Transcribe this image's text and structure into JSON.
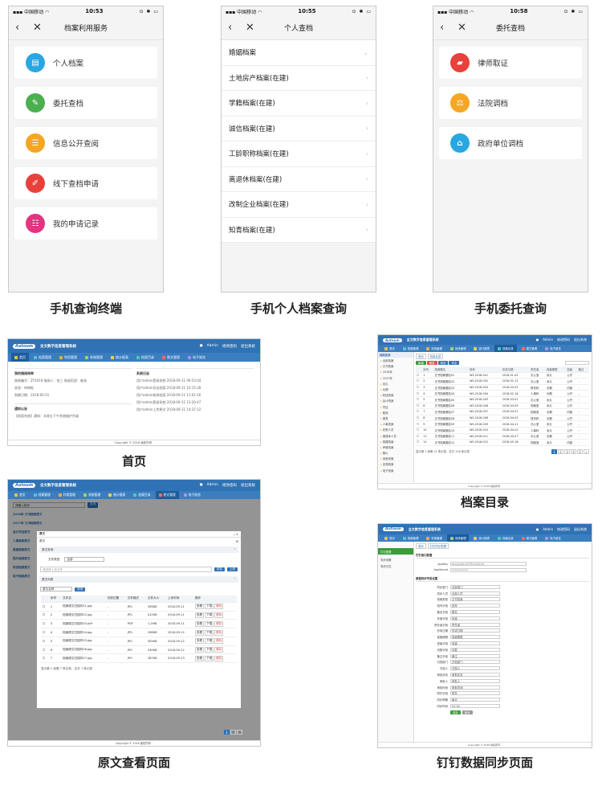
{
  "phone_status": {
    "carrier": "中国移动",
    "screen1_time": "10:53",
    "screen2_time": "10:55",
    "screen3_time": "10:58",
    "right_icons": "⊙ ✱ ▭"
  },
  "screen1": {
    "title": "档案利用服务",
    "items": [
      {
        "label": "个人档案",
        "icon": "person-file-icon",
        "color": "#29a7e1"
      },
      {
        "label": "委托查档",
        "icon": "delegate-icon",
        "color": "#4cb050"
      },
      {
        "label": "信息公开查阅",
        "icon": "info-public-icon",
        "color": "#f5a623"
      },
      {
        "label": "线下查档申请",
        "icon": "offline-apply-icon",
        "color": "#e8413c"
      },
      {
        "label": "我的申请记录",
        "icon": "my-records-icon",
        "color": "#e3347f"
      }
    ],
    "caption": "手机查询终端"
  },
  "screen2": {
    "title": "个人查档",
    "items": [
      "婚姻档案",
      "土地房产档案(在建)",
      "学籍档案(在建)",
      "诚信档案(在建)",
      "工龄职称档案(在建)",
      "离退休档案(在建)",
      "改制企业档案(在建)",
      "知青档案(在建)"
    ],
    "caption": "手机个人档案查询"
  },
  "screen3": {
    "title": "委托查档",
    "items": [
      {
        "label": "律师取证",
        "icon": "briefcase-icon",
        "color": "#e8413c"
      },
      {
        "label": "法院调档",
        "icon": "scales-icon",
        "color": "#f5a623"
      },
      {
        "label": "政府单位调档",
        "icon": "government-icon",
        "color": "#29a7e1"
      }
    ],
    "caption": "手机委托查询"
  },
  "desktop": {
    "logo": "Autoum",
    "system_title": "全文数字信息管理系统",
    "user": "Admin",
    "top_links": [
      "修改密码",
      "退出系统"
    ],
    "menu": [
      "首页",
      "档案管理",
      "利用管理",
      "系统管理",
      "统计报表",
      "档案目录",
      "原文管理",
      "电子阅览"
    ],
    "footer": "Copyright © 2018 版权所有 ·"
  },
  "home": {
    "left_title": "我的借阅待审",
    "left_lines": [
      "借阅编号：ZY2018 借阅人：张三 借阅用途：查阅",
      "状态：待审批",
      "到期日期：2018-06-01"
    ],
    "left_title2": "通知公告",
    "left_lines2": [
      "【档案系统】通知：本周五下午系统维护升级"
    ],
    "right_title": "系统日志",
    "right_lines": [
      "用户admin登录系统 2018-09-11 09:53:04",
      "用户admin导出档案 2018-09-11 10:15:28",
      "用户admin修改档案 2018-09-11 11:02:16",
      "用户admin登录系统 2018-09-11 13:20:47",
      "用户admin上传原文 2018-09-11 14:37:12"
    ],
    "caption": "首页"
  },
  "catalog": {
    "sidebar_title": "档案目录",
    "tree": [
      "全部档案",
      "文书档案",
      "2018年",
      "2017年",
      "永久",
      "长期",
      "科技档案",
      "会计档案",
      "凭证",
      "账簿",
      "报表",
      "人事档案",
      "在职人员",
      "离退休人员",
      "基建档案",
      "声像档案",
      "照片",
      "录音录像",
      "实物档案",
      "电子档案"
    ],
    "tabs": [
      "首页",
      "档案目录"
    ],
    "toolbar": [
      "新增",
      "删除",
      "修改",
      "导出"
    ],
    "headers": [
      "",
      "序号",
      "档案题名",
      "档号",
      "形成日期",
      "责任者",
      "保管期限",
      "密级",
      "备注"
    ],
    "rows": [
      [
        "1",
        "文书档案题名01",
        "WS-2018-001",
        "2018-01-05",
        "办公室",
        "永久",
        "公开",
        "-"
      ],
      [
        "2",
        "文书档案题名02",
        "WS-2018-002",
        "2018-01-12",
        "办公室",
        "永久",
        "公开",
        "-"
      ],
      [
        "3",
        "文书档案题名03",
        "WS-2018-003",
        "2018-02-02",
        "财务科",
        "长期",
        "内部",
        "-"
      ],
      [
        "4",
        "文书档案题名04",
        "WS-2018-004",
        "2018-02-16",
        "人事科",
        "长期",
        "公开",
        "-"
      ],
      [
        "5",
        "文书档案题名05",
        "WS-2018-005",
        "2018-03-01",
        "办公室",
        "永久",
        "公开",
        "-"
      ],
      [
        "6",
        "文书档案题名06",
        "WS-2018-006",
        "2018-03-09",
        "档案室",
        "永久",
        "公开",
        "-"
      ],
      [
        "7",
        "文书档案题名07",
        "WS-2018-007",
        "2018-03-22",
        "档案室",
        "长期",
        "内部",
        "-"
      ],
      [
        "8",
        "文书档案题名08",
        "WS-2018-008",
        "2018-04-03",
        "财务科",
        "长期",
        "公开",
        "-"
      ],
      [
        "9",
        "文书档案题名09",
        "WS-2018-009",
        "2018-04-11",
        "办公室",
        "永久",
        "公开",
        "-"
      ],
      [
        "10",
        "文书档案题名10",
        "WS-2018-010",
        "2018-04-20",
        "人事科",
        "永久",
        "公开",
        "-"
      ],
      [
        "11",
        "文书档案题名11",
        "WS-2018-011",
        "2018-05-07",
        "办公室",
        "长期",
        "公开",
        "-"
      ],
      [
        "12",
        "文书档案题名12",
        "WS-2018-012",
        "2018-05-18",
        "档案室",
        "永久",
        "内部",
        "-"
      ]
    ],
    "pager_text": "显示第 1 到第 12 条记录，总共 128 条记录",
    "pages": [
      "1",
      "2",
      "3",
      "4",
      "5",
      "»"
    ],
    "caption": "档案目录"
  },
  "viewer": {
    "tabs": [
      "首页",
      "原文管理"
    ],
    "search_placeholder": "请输入档号",
    "search_button": "查询",
    "bg_items": [
      "2018年 文书档案原文",
      "2017年 文书档案原文",
      "会计凭证原文",
      "人事档案原文",
      "基建档案原文",
      "照片档案原文",
      "科技档案原文",
      "电子档案原文"
    ],
    "modal_title": "原文",
    "modal_sub": "原文",
    "section1": "原文查询",
    "select_label": "文件类型",
    "select_value": "全部",
    "upload_placeholder": "请选择上传文件",
    "browse": "浏览",
    "upload": "上传",
    "section2": "原文列表",
    "filter_value": "原文名称",
    "filter_button": "查询",
    "headers": [
      "",
      "序号",
      "文件名",
      "存放位置",
      "文件格式",
      "文件大小",
      "上传时间",
      "操作"
    ],
    "rows": [
      [
        "1",
        "档案原文扫描件01.jpg",
        "-",
        "JPG",
        "356KB",
        "2018-09-11"
      ],
      [
        "2",
        "档案原文扫描件02.jpg",
        "-",
        "JPG",
        "412KB",
        "2018-09-11"
      ],
      [
        "3",
        "档案原文扫描件03.pdf",
        "-",
        "PDF",
        "1.2MB",
        "2018-09-11"
      ],
      [
        "4",
        "档案原文扫描件04.jpg",
        "-",
        "JPG",
        "298KB",
        "2018-09-12"
      ],
      [
        "5",
        "档案原文扫描件05.jpg",
        "-",
        "JPG",
        "305KB",
        "2018-09-12"
      ],
      [
        "6",
        "档案原文扫描件06.jpg",
        "-",
        "JPG",
        "330KB",
        "2018-09-12"
      ],
      [
        "7",
        "档案原文扫描件07.jpg",
        "-",
        "JPG",
        "287KB",
        "2018-09-13"
      ]
    ],
    "ops": [
      "查看",
      "下载",
      "删除"
    ],
    "modal_footer": "显示第 1 到第 7 条记录，总共 7 条记录",
    "pages": [
      "1",
      "2",
      "3"
    ],
    "caption": "原文查看页面"
  },
  "dingtalk": {
    "sidebar": [
      "钉钉配置",
      "同步设置",
      "同步日志"
    ],
    "tabs": [
      "首页",
      "钉钉同步配置"
    ],
    "section1": "钉钉接口配置",
    "fields1": [
      {
        "k": "AppKey",
        "v": "ding2a8c1b7f9e4d3c5a"
      },
      {
        "k": "AppSecret",
        "v": "************"
      }
    ],
    "section2": "数据同步字段设置",
    "fields2": [
      {
        "k": "同步部门",
        "v": "全部部门"
      },
      {
        "k": "同步人员",
        "v": "全部人员"
      },
      {
        "k": "档案类型",
        "v": "文书档案"
      },
      {
        "k": "档号字段",
        "v": "档号"
      },
      {
        "k": "题名字段",
        "v": "题名"
      },
      {
        "k": "年度字段",
        "v": "年度"
      },
      {
        "k": "责任者字段",
        "v": "责任者"
      },
      {
        "k": "形成日期",
        "v": "形成日期"
      },
      {
        "k": "保管期限",
        "v": "保管期限"
      },
      {
        "k": "密级字段",
        "v": "密级"
      },
      {
        "k": "页数字段",
        "v": "页数"
      },
      {
        "k": "备注字段",
        "v": "备注"
      },
      {
        "k": "归档部门",
        "v": "归档部门"
      },
      {
        "k": "归档人",
        "v": "归档人"
      },
      {
        "k": "审批状态",
        "v": "审批状态"
      },
      {
        "k": "审批人",
        "v": "审批人"
      },
      {
        "k": "审批时间",
        "v": "审批时间"
      },
      {
        "k": "附件字段",
        "v": "附件"
      },
      {
        "k": "同步周期",
        "v": "每天"
      },
      {
        "k": "同步时间",
        "v": "02:00"
      }
    ],
    "save": "保存",
    "cancel": "取消",
    "caption": "钉钉数据同步页面"
  }
}
